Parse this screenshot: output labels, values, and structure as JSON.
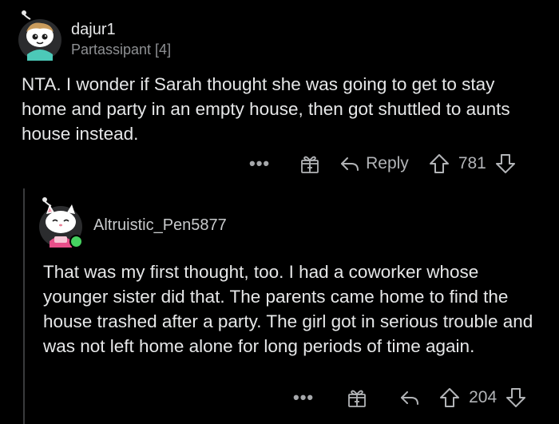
{
  "comments": [
    {
      "username": "dajur1",
      "flair": "Partassipant [4]",
      "body": "NTA. I wonder if Sarah thought she was going to get to stay home and party in an empty house, then got shuttled to aunts house instead.",
      "actions": {
        "more": "•••",
        "reply_label": "Reply",
        "score": "781"
      }
    },
    {
      "username": "Altruistic_Pen5877",
      "body": "That was my first thought, too. I had a coworker whose younger sister did that. The parents came home to find the house trashed after a party. The girl got in serious trouble and was not left home alone for long periods of time again.",
      "actions": {
        "more": "•••",
        "score": "204"
      }
    }
  ],
  "colors": {
    "background": "#000000",
    "text": "#e6e7e8",
    "muted": "#8e9093",
    "online": "#46d160"
  },
  "icons": [
    "avatar",
    "gift-award-icon",
    "reply-arrow-icon",
    "upvote-icon",
    "downvote-icon",
    "more-options-icon"
  ]
}
